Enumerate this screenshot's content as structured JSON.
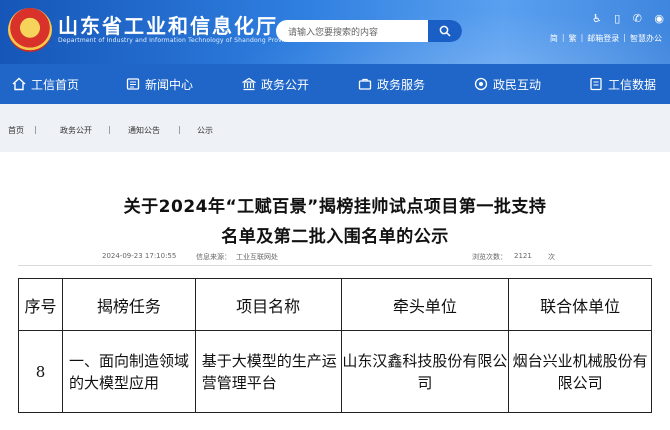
{
  "header": {
    "site_title": "山东省工业和信息化厅",
    "site_subtitle": "Department of Industry and Information Technology of Shandong Province",
    "search_placeholder": "请输入您要搜索的内容",
    "links": [
      "简",
      "繁",
      "邮箱登录",
      "智慧办公"
    ]
  },
  "nav": {
    "items": [
      {
        "label": "工信首页",
        "icon": "home-icon"
      },
      {
        "label": "新闻中心",
        "icon": "news-icon"
      },
      {
        "label": "政务公开",
        "icon": "gov-icon"
      },
      {
        "label": "政务服务",
        "icon": "service-icon"
      },
      {
        "label": "政民互动",
        "icon": "interact-icon"
      },
      {
        "label": "工信数据",
        "icon": "data-icon"
      }
    ]
  },
  "breadcrumb": [
    "首页",
    "政务公开",
    "通知公告",
    "公示"
  ],
  "article": {
    "title_line1": "关于2024年“工赋百景”揭榜挂帅试点项目第一批支持",
    "title_line2": "名单及第二批入围名单的公示",
    "date": "2024-09-23 17:10:55",
    "source_label": "信息来源：",
    "source": "工业互联网处",
    "views_label": "浏览次数：",
    "views": "2121",
    "views_unit": "次"
  },
  "table": {
    "headers": [
      "序号",
      "揭榜任务",
      "项目名称",
      "牵头单位",
      "联合体单位"
    ],
    "rows": [
      [
        "8",
        "一、面向制造领域的大模型应用",
        "基于大模型的生产运营管理平台",
        "山东汉鑫科技股份有限公司",
        "烟台兴业机械股份有限公司"
      ]
    ]
  }
}
